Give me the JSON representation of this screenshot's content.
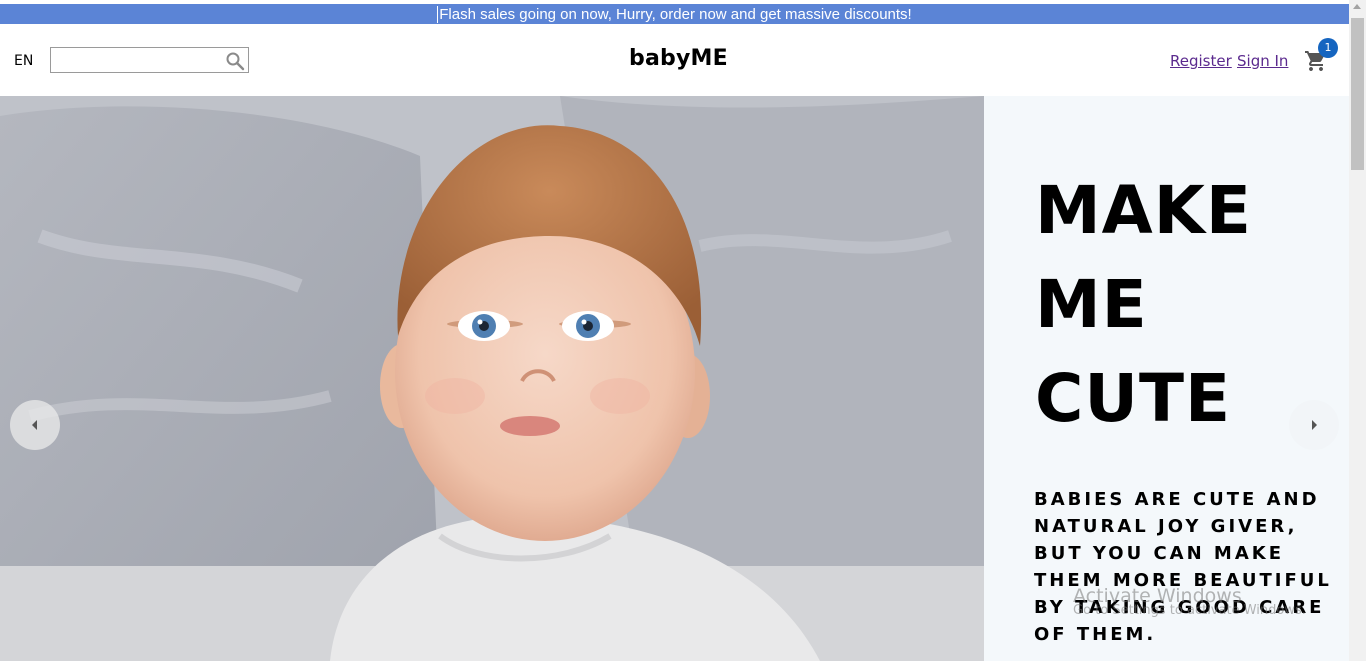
{
  "announcement": {
    "text": "Flash sales going on now, Hurry, order now and get massive discounts!"
  },
  "header": {
    "language": "EN",
    "search": {
      "value": "",
      "placeholder": "",
      "icon": "search-icon"
    },
    "brand": "babyME",
    "register_label": "Register",
    "signin_label": "Sign In",
    "cart": {
      "icon": "cart-icon",
      "count": "1"
    }
  },
  "hero": {
    "headline": "MAKE ME CUTE",
    "tagline": "Babies are cute and natural joy giver, but you can make them more beautiful by taking good care of them.",
    "prev_icon": "chevron-left-icon",
    "next_icon": "chevron-right-icon"
  },
  "watermark": {
    "title": "Activate Windows",
    "subtitle": "Go to Settings to activate Windows."
  },
  "colors": {
    "announcement_bg": "#5b84d6",
    "link": "#5b2a8e",
    "badge": "#1565c0",
    "panel_bg": "#f4f8fb"
  }
}
